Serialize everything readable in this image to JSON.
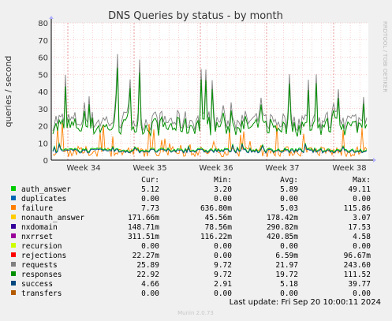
{
  "chart_data": {
    "type": "line",
    "title": "DNS Queries by status - by month",
    "ylabel": "queries / second",
    "side_label": "RRDTOOL / TOBI OETIKER",
    "ylim": [
      0,
      80
    ],
    "y_ticks": [
      "0",
      "10",
      "20",
      "30",
      "40",
      "50",
      "60",
      "70",
      "80"
    ],
    "x_ticks": [
      "Week 34",
      "Week 35",
      "Week 36",
      "Week 37",
      "Week 38"
    ],
    "grid": true,
    "legend_columns": [
      "Cur:",
      "Min:",
      "Avg:",
      "Max:"
    ],
    "series": [
      {
        "name": "auth_answer",
        "color": "#00cc00",
        "cur": "5.12",
        "min": "3.20",
        "avg": "5.89",
        "max": "49.11"
      },
      {
        "name": "duplicates",
        "color": "#0066b3",
        "cur": "0.00",
        "min": "0.00",
        "avg": "0.00",
        "max": "0.00"
      },
      {
        "name": "failure",
        "color": "#ff8000",
        "cur": "7.73",
        "min": "636.80m",
        "avg": "5.03",
        "max": "115.86"
      },
      {
        "name": "nonauth_answer",
        "color": "#ffcc00",
        "cur": "171.66m",
        "min": "45.56m",
        "avg": "178.42m",
        "max": "3.07"
      },
      {
        "name": "nxdomain",
        "color": "#330099",
        "cur": "148.71m",
        "min": "78.56m",
        "avg": "290.82m",
        "max": "17.53"
      },
      {
        "name": "nxrrset",
        "color": "#990099",
        "cur": "311.51m",
        "min": "116.22m",
        "avg": "420.85m",
        "max": "4.58"
      },
      {
        "name": "recursion",
        "color": "#ccff00",
        "cur": "0.00",
        "min": "0.00",
        "avg": "0.00",
        "max": "0.00"
      },
      {
        "name": "rejections",
        "color": "#ff0000",
        "cur": "22.27m",
        "min": "0.00",
        "avg": "6.59m",
        "max": "96.67m"
      },
      {
        "name": "requests",
        "color": "#808080",
        "cur": "25.89",
        "min": "9.72",
        "avg": "21.97",
        "max": "243.60"
      },
      {
        "name": "responses",
        "color": "#008f00",
        "cur": "22.92",
        "min": "9.72",
        "avg": "19.72",
        "max": "111.52"
      },
      {
        "name": "success",
        "color": "#00487d",
        "cur": "4.66",
        "min": "2.91",
        "avg": "5.18",
        "max": "39.77"
      },
      {
        "name": "transfers",
        "color": "#b35a00",
        "cur": "0.00",
        "min": "0.00",
        "avg": "0.00",
        "max": "0.00"
      }
    ]
  },
  "footer": {
    "last_update": "Last update: Fri Sep 20 10:00:11 2024",
    "version": "Munin 2.0.73"
  }
}
